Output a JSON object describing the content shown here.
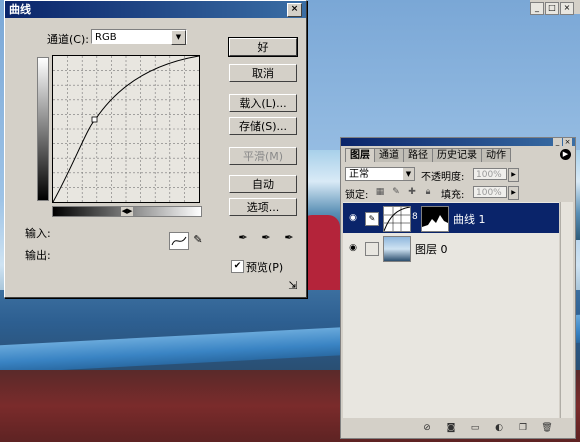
{
  "window_controls": [
    "_",
    "□",
    "×"
  ],
  "curves_dialog": {
    "title": "曲线",
    "close_label": "×",
    "channel_label": "通道(C):",
    "channel_value": "RGB",
    "buttons": {
      "ok": "好",
      "cancel": "取消",
      "load": "载入(L)...",
      "save": "存储(S)...",
      "smooth": "平滑(M)",
      "auto": "自动",
      "options": "选项..."
    },
    "input_label": "输入:",
    "output_label": "输出:",
    "preview_label": "预览(P)",
    "preview_checked": true
  },
  "layers_panel": {
    "tabs": [
      "图层",
      "通道",
      "路径",
      "历史记录",
      "动作"
    ],
    "active_tab": "图层",
    "blend_mode": "正常",
    "opacity_label": "不透明度:",
    "opacity_value": "100%",
    "lock_label": "锁定:",
    "fill_label": "填充:",
    "fill_value": "100%",
    "layers": [
      {
        "name": "曲线 1",
        "selected": true,
        "type": "adjustment"
      },
      {
        "name": "图层 0",
        "selected": false,
        "type": "image"
      }
    ]
  },
  "colors": {
    "titlebar": "#0a246a",
    "dialog_bg": "#d4d0c8",
    "selected_layer": "#0a246a"
  }
}
